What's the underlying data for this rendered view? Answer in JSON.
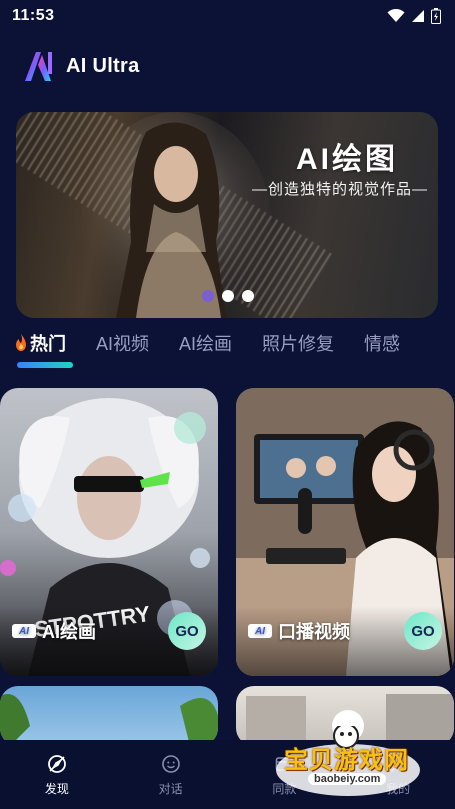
{
  "status_bar": {
    "time": "11:53"
  },
  "app": {
    "title": "AI Ultra"
  },
  "banner": {
    "title": "AI绘图",
    "subtitle": "—创造独特的视觉作品—",
    "dots": 3,
    "active_dot": 0
  },
  "tabs": [
    {
      "label": "热门",
      "active": true
    },
    {
      "label": "AI视频",
      "active": false
    },
    {
      "label": "AI绘画",
      "active": false
    },
    {
      "label": "照片修复",
      "active": false
    },
    {
      "label": "情感",
      "active": false
    }
  ],
  "cards": [
    {
      "chip": "AI",
      "label": "AI绘画",
      "button": "GO"
    },
    {
      "chip": "AI",
      "label": "口播视频",
      "button": "GO"
    }
  ],
  "bottom_nav": [
    {
      "label": "发现",
      "icon": "compass-icon",
      "active": true
    },
    {
      "label": "对话",
      "icon": "smile-icon",
      "active": false
    },
    {
      "label": "同款",
      "icon": "card-icon",
      "active": false
    },
    {
      "label": "我的",
      "icon": "profile-icon",
      "active": false
    }
  ],
  "watermark": {
    "text": "宝贝游戏网",
    "url": "baobeiy.com"
  },
  "colors": {
    "background": "#0b1236",
    "accent": "#22d3c5",
    "active_dot": "#7a5fd0"
  }
}
